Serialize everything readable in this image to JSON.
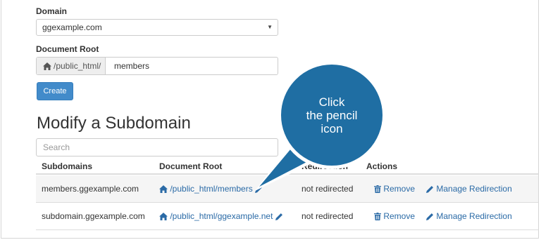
{
  "form": {
    "domain_label": "Domain",
    "domain_value": "ggexample.com",
    "docroot_label": "Document Root",
    "docroot_prefix": "/public_html/",
    "docroot_value": "members",
    "create_label": "Create"
  },
  "modify": {
    "title": "Modify a Subdomain",
    "search_placeholder": "Search",
    "columns": {
      "subdomains": "Subdomains",
      "document_root": "Document Root",
      "redirection": "Redirection",
      "actions": "Actions"
    },
    "rows": [
      {
        "subdomain": "members.ggexample.com",
        "document_root": "/public_html/members",
        "redirection": "not redirected",
        "remove": "Remove",
        "manage": "Manage Redirection"
      },
      {
        "subdomain": "subdomain.ggexample.com",
        "document_root": "/public_html/ggexample.net",
        "redirection": "not redirected",
        "remove": "Remove",
        "manage": "Manage Redirection"
      }
    ]
  },
  "callout": {
    "line1": "Click",
    "line2": "the pencil",
    "line3": "icon",
    "color": "#1f6ea3"
  },
  "icons": {
    "home": "home-icon",
    "pencil": "pencil-icon",
    "trash": "trash-icon",
    "caret": "caret-down-icon"
  },
  "colors": {
    "primary_button": "#428bca",
    "link": "#2a6aa6",
    "row_stripe": "#f5f5f5"
  }
}
